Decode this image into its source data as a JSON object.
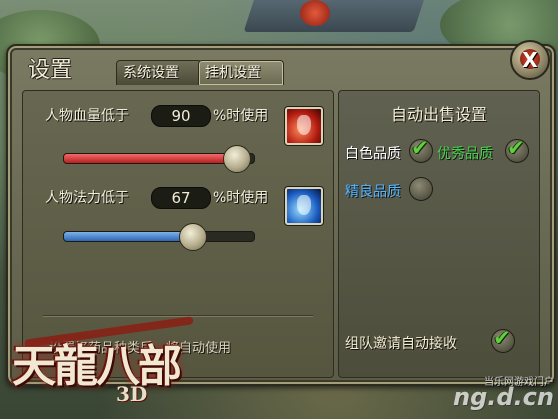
{
  "panel": {
    "title": "设置",
    "tabs": [
      {
        "label": "系统设置",
        "active": false
      },
      {
        "label": "挂机设置",
        "active": true
      }
    ],
    "close_glyph": "X"
  },
  "potions": {
    "hp": {
      "label_prefix": "人物血量低于",
      "value": "90",
      "label_suffix": "%时使用",
      "slider_percent": 90,
      "icon": "red-potion-icon",
      "color": "#d62a2a"
    },
    "mp": {
      "label_prefix": "人物法力低于",
      "value": "67",
      "label_suffix": "%时使用",
      "slider_percent": 67,
      "icon": "blue-potion-icon",
      "color": "#2d66b3"
    },
    "note": "设置好药品种类后，将自动使用"
  },
  "auto_sell": {
    "title": "自动出售设置",
    "white": {
      "label": "白色品质",
      "checked": true,
      "color": "#ffffff"
    },
    "excellent": {
      "label": "优秀品质",
      "checked": true,
      "color": "#45d24a"
    },
    "fine": {
      "label": "精良品质",
      "checked": false,
      "color": "#55b6ff"
    },
    "team_invite": {
      "label": "组队邀请自动接收",
      "checked": true
    }
  },
  "logo": {
    "main": "天龍八部",
    "sub": "3D"
  },
  "watermark": {
    "line1": "当乐网游戏门户",
    "line2": "ng.d.cn"
  }
}
